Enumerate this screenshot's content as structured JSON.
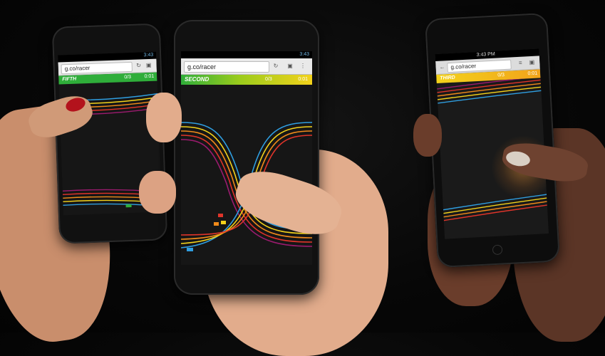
{
  "phones": {
    "left": {
      "status_time": "3:43",
      "url": "g.co/racer",
      "place": "FIFTH",
      "laps": "0/3",
      "time": "0:01",
      "place_color": "#2fae3a"
    },
    "center": {
      "status_time": "3:43",
      "url": "g.co/racer",
      "place": "SECOND",
      "laps": "0/3",
      "time": "0:01",
      "place_color": "#9ccc1c"
    },
    "right": {
      "status_time": "3:43 PM",
      "url": "g.co/racer",
      "place": "THIRD",
      "laps": "0/3",
      "time": "0:01",
      "place_color": "#f2a31b"
    }
  },
  "track_colors": [
    "#2f9ee0",
    "#f3d21b",
    "#f08a1a",
    "#e0342a",
    "#9b1b6e"
  ],
  "icons": {
    "reload": "reload-icon",
    "tabs": "tabs-icon",
    "menu": "menu-icon",
    "back": "back-arrow-icon"
  }
}
